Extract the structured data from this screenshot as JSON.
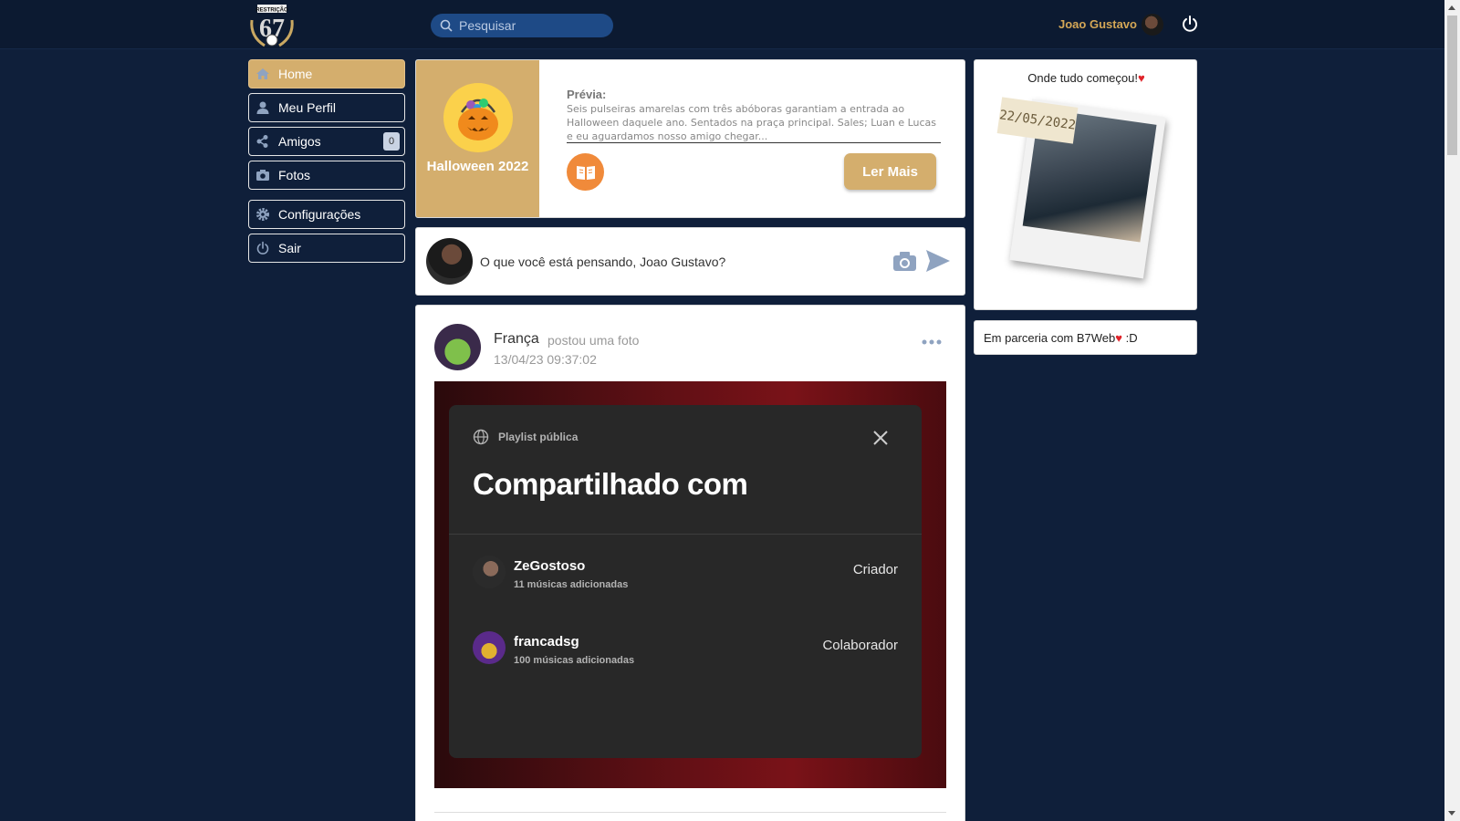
{
  "header": {
    "logo_text": "RESTRIÇÃO 67",
    "search_placeholder": "Pesquisar",
    "user_name": "Joao Gustavo"
  },
  "sidebar": {
    "items": [
      {
        "label": "Home",
        "icon": "home-icon",
        "active": true
      },
      {
        "label": "Meu Perfil",
        "icon": "user-icon"
      },
      {
        "label": "Amigos",
        "icon": "friends-icon",
        "badge": "0"
      },
      {
        "label": "Fotos",
        "icon": "camera-icon"
      },
      {
        "label": "Configurações",
        "icon": "gear-icon"
      },
      {
        "label": "Sair",
        "icon": "power-icon"
      }
    ]
  },
  "highlight": {
    "title": "Halloween 2022",
    "preview_label": "Prévia:",
    "preview_text": "Seis pulseiras amarelas com três abóboras garantiam a entrada ao Halloween daquele ano. Sentados na praça principal. Sales; Luan e Lucas e eu aguardamos nosso amigo chegar...",
    "read_more": "Ler Mais"
  },
  "composer": {
    "placeholder": "O que você está pensando, Joao Gustavo?"
  },
  "post": {
    "author": "França",
    "action": "postou uma foto",
    "date": "13/04/23 09:37:02",
    "modal": {
      "visibility": "Playlist pública",
      "title": "Compartilhado com",
      "members": [
        {
          "name": "ZeGostoso",
          "sub": "11 músicas adicionadas",
          "role": "Criador"
        },
        {
          "name": "francadsg",
          "sub": "100 músicas adicionadas",
          "role": "Colaborador"
        }
      ]
    }
  },
  "right": {
    "polaroid_title": "Onde tudo começou!",
    "polaroid_date": "22/05/2022",
    "partner_text": "Em parceria com B7Web",
    "partner_suffix": ":D"
  },
  "colors": {
    "background": "#0f1f3a",
    "accent": "#d4ae6d",
    "header_name": "#d4a756",
    "orange": "#f08a3a"
  }
}
